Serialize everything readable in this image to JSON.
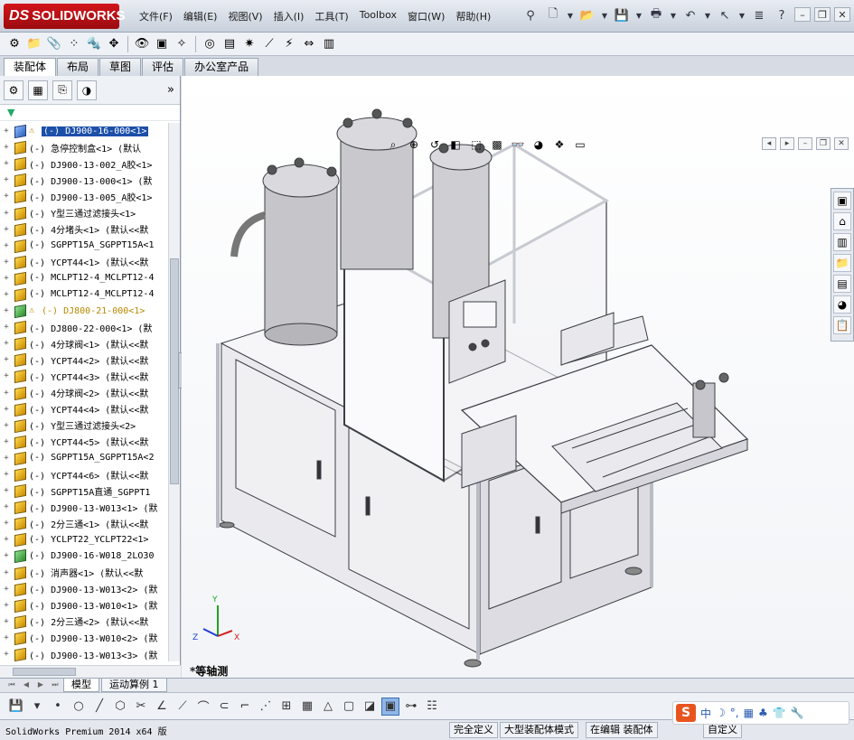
{
  "app": {
    "logo": "SOLIDWORKS",
    "logo_prefix": "DS"
  },
  "menu": [
    "文件(F)",
    "编辑(E)",
    "视图(V)",
    "插入(I)",
    "工具(T)",
    "Toolbox",
    "窗口(W)",
    "帮助(H)"
  ],
  "tabs": [
    "装配体",
    "布局",
    "草图",
    "评估",
    "办公室产品"
  ],
  "active_tab": "装配体",
  "tree": [
    {
      "label": "(-) DJ900-16-000<1>",
      "icon": "assembly-blue-icon",
      "warning": true,
      "selected": true
    },
    {
      "label": "(-) 急停控制盒<1> (默认",
      "icon": "part-icon"
    },
    {
      "label": "(-) DJ900-13-002_A胶<1>",
      "icon": "part-icon"
    },
    {
      "label": "(-) DJ900-13-000<1> (默",
      "icon": "part-icon"
    },
    {
      "label": "(-) DJ900-13-005_A胶<1>",
      "icon": "part-icon"
    },
    {
      "label": "(-) Y型三通过滤接头<1>",
      "icon": "part-icon"
    },
    {
      "label": "(-) 4分堵头<1> (默认<<默",
      "icon": "part-icon"
    },
    {
      "label": "(-) SGPPT15A_SGPPT15A<1",
      "icon": "part-icon"
    },
    {
      "label": "(-) YCPT44<1> (默认<<默",
      "icon": "part-icon"
    },
    {
      "label": "(-) MCLPT12-4_MCLPT12-4",
      "icon": "part-icon"
    },
    {
      "label": "(-) MCLPT12-4_MCLPT12-4",
      "icon": "part-icon"
    },
    {
      "label": "(-) DJ800-21-000<1>",
      "icon": "assembly-green-icon",
      "warning": true
    },
    {
      "label": "(-) DJ800-22-000<1> (默",
      "icon": "part-icon"
    },
    {
      "label": "(-) 4分球阀<1> (默认<<默",
      "icon": "part-icon"
    },
    {
      "label": "(-) YCPT44<2> (默认<<默",
      "icon": "part-icon"
    },
    {
      "label": "(-) YCPT44<3> (默认<<默",
      "icon": "part-icon"
    },
    {
      "label": "(-) 4分球阀<2> (默认<<默",
      "icon": "part-icon"
    },
    {
      "label": "(-) YCPT44<4> (默认<<默",
      "icon": "part-icon"
    },
    {
      "label": "(-) Y型三通过滤接头<2>",
      "icon": "part-icon"
    },
    {
      "label": "(-) YCPT44<5> (默认<<默",
      "icon": "part-icon"
    },
    {
      "label": "(-) SGPPT15A_SGPPT15A<2",
      "icon": "part-icon"
    },
    {
      "label": "(-) YCPT44<6> (默认<<默",
      "icon": "part-icon"
    },
    {
      "label": "(-) SGPPT15A直通_SGPPT1",
      "icon": "part-icon"
    },
    {
      "label": "(-) DJ900-13-W013<1> (默",
      "icon": "part-icon"
    },
    {
      "label": "(-) 2分三通<1> (默认<<默",
      "icon": "part-icon"
    },
    {
      "label": "(-) YCLPT22_YCLPT22<1>",
      "icon": "part-icon"
    },
    {
      "label": "(-) DJ900-16-W018_2LO30",
      "icon": "assembly-green-icon"
    },
    {
      "label": "(-) 消声器<1> (默认<<默",
      "icon": "part-icon"
    },
    {
      "label": "(-) DJ900-13-W013<2> (默",
      "icon": "part-icon"
    },
    {
      "label": "(-) DJ900-13-W010<1> (默",
      "icon": "part-icon"
    },
    {
      "label": "(-) 2分三通<2> (默认<<默",
      "icon": "part-icon"
    },
    {
      "label": "(-) DJ900-13-W010<2> (默",
      "icon": "part-icon"
    },
    {
      "label": "(-) DJ900-13-W013<3> (默",
      "icon": "part-icon"
    }
  ],
  "viewport": {
    "view_label": "*等轴测"
  },
  "model_tabs": [
    "模型",
    "运动算例 1"
  ],
  "status": {
    "app_version": "SolidWorks Premium 2014 x64 版",
    "definition": "完全定义",
    "mode": "大型装配体模式",
    "editing": "在编辑 装配体",
    "custom": "自定义"
  },
  "ime": {
    "logo": "S",
    "chars": [
      "中",
      "☽",
      "°,",
      "▦",
      "♣",
      "👕",
      "🔧"
    ]
  },
  "colors": {
    "accent": "#1c4fa8",
    "brand": "#c4161c",
    "warning": "#c48a00"
  }
}
